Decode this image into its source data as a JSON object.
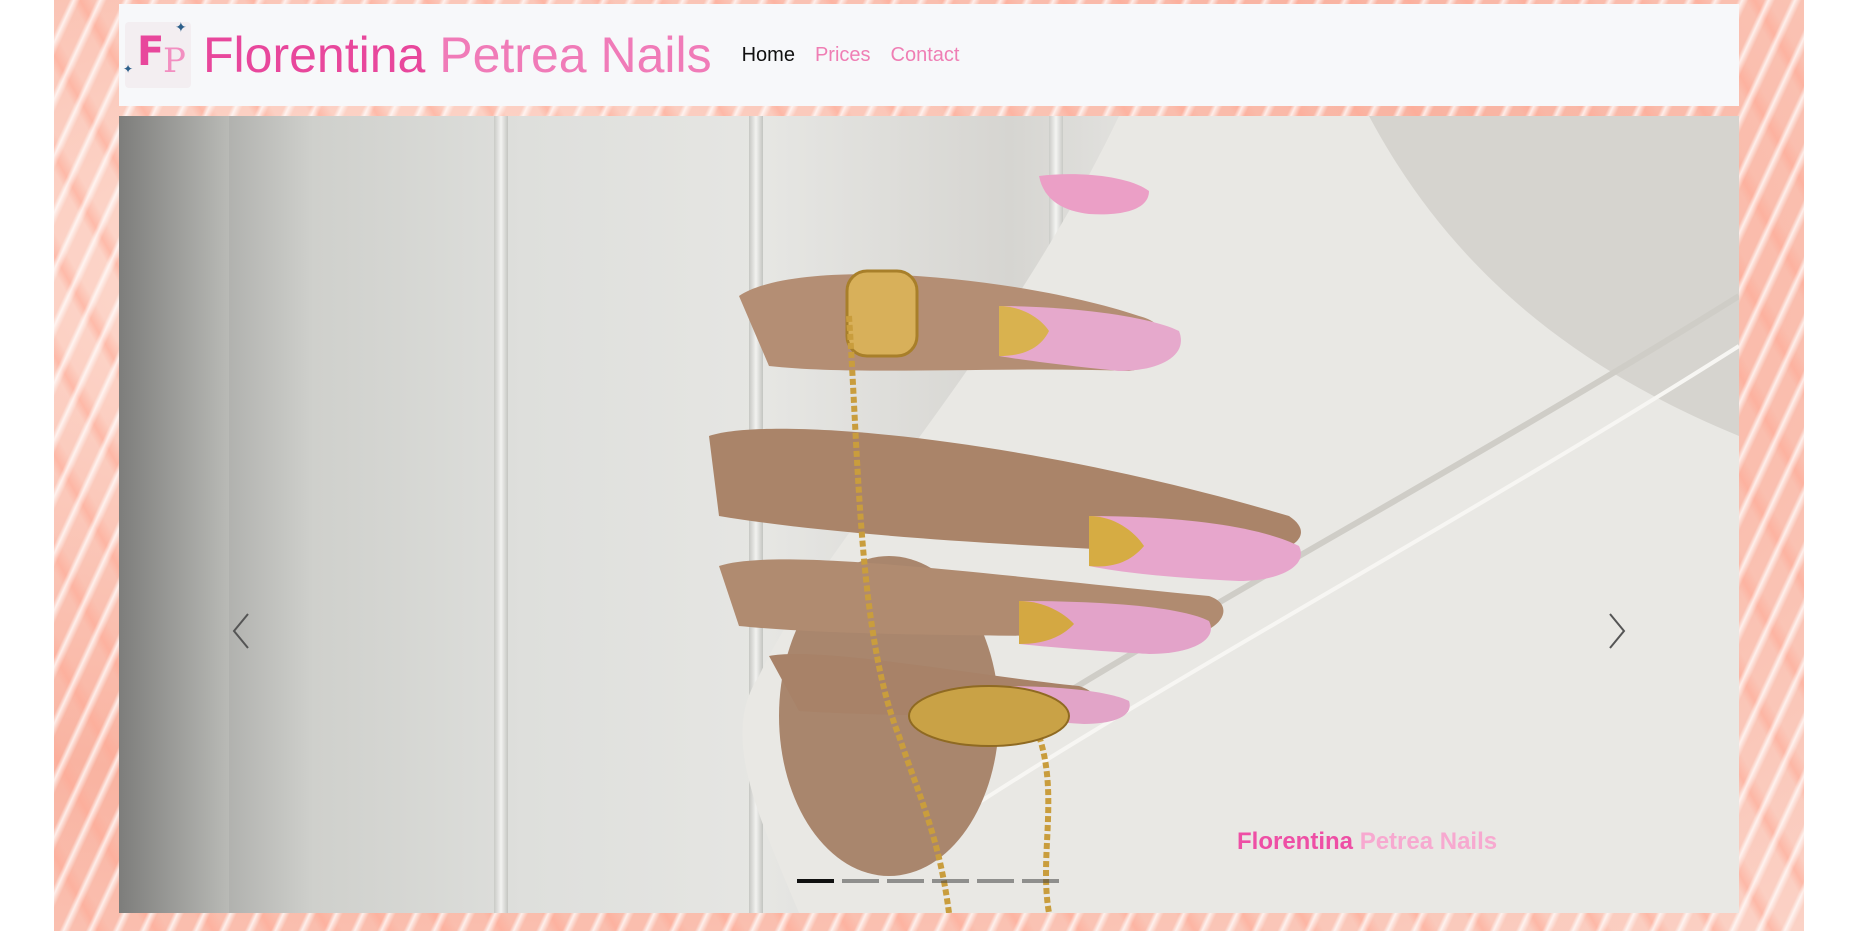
{
  "brand": {
    "logo_letters": "FP",
    "name_first": "Florentina",
    "name_rest": "Petrea Nails"
  },
  "nav": {
    "items": [
      {
        "label": "Home",
        "active": true
      },
      {
        "label": "Prices",
        "active": false
      },
      {
        "label": "Contact",
        "active": false
      }
    ]
  },
  "carousel": {
    "caption_first": "Florentina",
    "caption_rest": "Petrea Nails",
    "slide_count": 6,
    "active_slide": 1,
    "prev_icon": "chevron-left-icon",
    "next_icon": "chevron-right-icon"
  },
  "colors": {
    "brand_pink": "#e8479c",
    "light_pink": "#f07bb8",
    "navbar_bg": "#f7f8fa",
    "marble_accent": "#f9b3a1"
  }
}
